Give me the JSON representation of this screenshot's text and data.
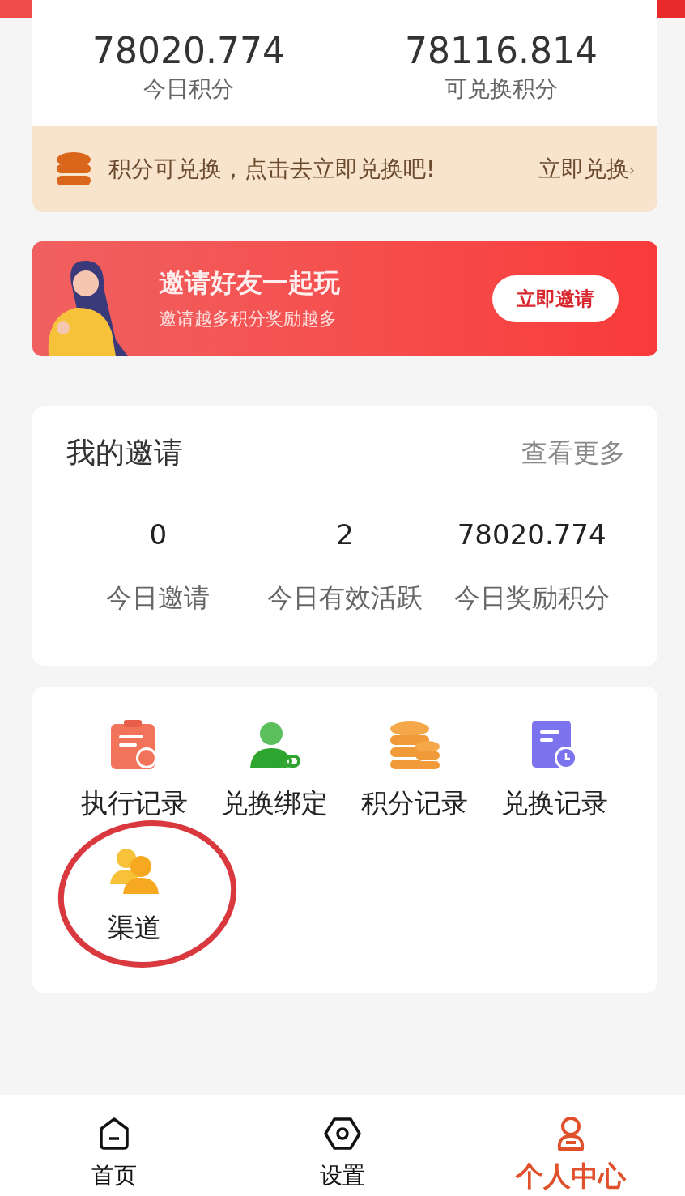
{
  "points": [
    {
      "value": "78020.774",
      "label": "今日积分"
    },
    {
      "value": "78116.814",
      "label": "可兑换积分"
    }
  ],
  "exchange_notice": {
    "text": "积分可兑换，点击去立即兑换吧!",
    "link": "立即兑换",
    "arrow": "›"
  },
  "invite_banner": {
    "title": "邀请好友一起玩",
    "subtitle": "邀请越多积分奖励越多",
    "button": "立即邀请"
  },
  "my_invites": {
    "title": "我的邀请",
    "more": "查看更多",
    "stats": [
      {
        "value": "0",
        "label": "今日邀请"
      },
      {
        "value": "2",
        "label": "今日有效活跃"
      },
      {
        "value": "78020.774",
        "label": "今日奖励积分"
      }
    ]
  },
  "menu": [
    {
      "kind": "clipboard",
      "label": "执行记录"
    },
    {
      "kind": "user-link",
      "label": "兑换绑定"
    },
    {
      "kind": "coins",
      "label": "积分记录"
    },
    {
      "kind": "doc-clock",
      "label": "兑换记录"
    },
    {
      "kind": "users",
      "label": "渠道"
    }
  ],
  "tabs": [
    {
      "kind": "home",
      "label": "首页",
      "selected": false
    },
    {
      "kind": "settings",
      "label": "设置",
      "selected": false
    },
    {
      "kind": "profile",
      "label": "个人中心",
      "selected": true
    }
  ]
}
